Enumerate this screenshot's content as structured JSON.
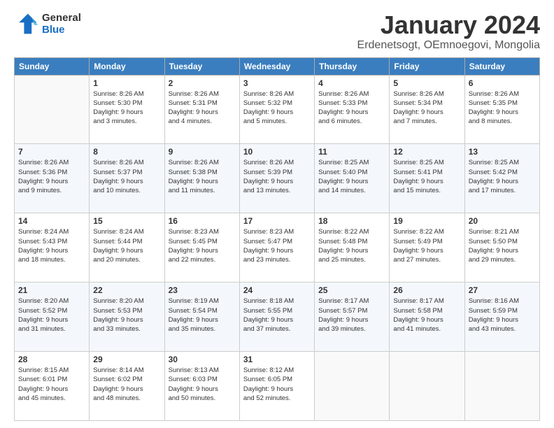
{
  "logo": {
    "line1": "General",
    "line2": "Blue"
  },
  "title": "January 2024",
  "subtitle": "Erdenetsogt, OEmnoegovi, Mongolia",
  "header_days": [
    "Sunday",
    "Monday",
    "Tuesday",
    "Wednesday",
    "Thursday",
    "Friday",
    "Saturday"
  ],
  "weeks": [
    [
      {
        "day": "",
        "info": ""
      },
      {
        "day": "1",
        "info": "Sunrise: 8:26 AM\nSunset: 5:30 PM\nDaylight: 9 hours\nand 3 minutes."
      },
      {
        "day": "2",
        "info": "Sunrise: 8:26 AM\nSunset: 5:31 PM\nDaylight: 9 hours\nand 4 minutes."
      },
      {
        "day": "3",
        "info": "Sunrise: 8:26 AM\nSunset: 5:32 PM\nDaylight: 9 hours\nand 5 minutes."
      },
      {
        "day": "4",
        "info": "Sunrise: 8:26 AM\nSunset: 5:33 PM\nDaylight: 9 hours\nand 6 minutes."
      },
      {
        "day": "5",
        "info": "Sunrise: 8:26 AM\nSunset: 5:34 PM\nDaylight: 9 hours\nand 7 minutes."
      },
      {
        "day": "6",
        "info": "Sunrise: 8:26 AM\nSunset: 5:35 PM\nDaylight: 9 hours\nand 8 minutes."
      }
    ],
    [
      {
        "day": "7",
        "info": "Sunrise: 8:26 AM\nSunset: 5:36 PM\nDaylight: 9 hours\nand 9 minutes."
      },
      {
        "day": "8",
        "info": "Sunrise: 8:26 AM\nSunset: 5:37 PM\nDaylight: 9 hours\nand 10 minutes."
      },
      {
        "day": "9",
        "info": "Sunrise: 8:26 AM\nSunset: 5:38 PM\nDaylight: 9 hours\nand 11 minutes."
      },
      {
        "day": "10",
        "info": "Sunrise: 8:26 AM\nSunset: 5:39 PM\nDaylight: 9 hours\nand 13 minutes."
      },
      {
        "day": "11",
        "info": "Sunrise: 8:25 AM\nSunset: 5:40 PM\nDaylight: 9 hours\nand 14 minutes."
      },
      {
        "day": "12",
        "info": "Sunrise: 8:25 AM\nSunset: 5:41 PM\nDaylight: 9 hours\nand 15 minutes."
      },
      {
        "day": "13",
        "info": "Sunrise: 8:25 AM\nSunset: 5:42 PM\nDaylight: 9 hours\nand 17 minutes."
      }
    ],
    [
      {
        "day": "14",
        "info": "Sunrise: 8:24 AM\nSunset: 5:43 PM\nDaylight: 9 hours\nand 18 minutes."
      },
      {
        "day": "15",
        "info": "Sunrise: 8:24 AM\nSunset: 5:44 PM\nDaylight: 9 hours\nand 20 minutes."
      },
      {
        "day": "16",
        "info": "Sunrise: 8:23 AM\nSunset: 5:45 PM\nDaylight: 9 hours\nand 22 minutes."
      },
      {
        "day": "17",
        "info": "Sunrise: 8:23 AM\nSunset: 5:47 PM\nDaylight: 9 hours\nand 23 minutes."
      },
      {
        "day": "18",
        "info": "Sunrise: 8:22 AM\nSunset: 5:48 PM\nDaylight: 9 hours\nand 25 minutes."
      },
      {
        "day": "19",
        "info": "Sunrise: 8:22 AM\nSunset: 5:49 PM\nDaylight: 9 hours\nand 27 minutes."
      },
      {
        "day": "20",
        "info": "Sunrise: 8:21 AM\nSunset: 5:50 PM\nDaylight: 9 hours\nand 29 minutes."
      }
    ],
    [
      {
        "day": "21",
        "info": "Sunrise: 8:20 AM\nSunset: 5:52 PM\nDaylight: 9 hours\nand 31 minutes."
      },
      {
        "day": "22",
        "info": "Sunrise: 8:20 AM\nSunset: 5:53 PM\nDaylight: 9 hours\nand 33 minutes."
      },
      {
        "day": "23",
        "info": "Sunrise: 8:19 AM\nSunset: 5:54 PM\nDaylight: 9 hours\nand 35 minutes."
      },
      {
        "day": "24",
        "info": "Sunrise: 8:18 AM\nSunset: 5:55 PM\nDaylight: 9 hours\nand 37 minutes."
      },
      {
        "day": "25",
        "info": "Sunrise: 8:17 AM\nSunset: 5:57 PM\nDaylight: 9 hours\nand 39 minutes."
      },
      {
        "day": "26",
        "info": "Sunrise: 8:17 AM\nSunset: 5:58 PM\nDaylight: 9 hours\nand 41 minutes."
      },
      {
        "day": "27",
        "info": "Sunrise: 8:16 AM\nSunset: 5:59 PM\nDaylight: 9 hours\nand 43 minutes."
      }
    ],
    [
      {
        "day": "28",
        "info": "Sunrise: 8:15 AM\nSunset: 6:01 PM\nDaylight: 9 hours\nand 45 minutes."
      },
      {
        "day": "29",
        "info": "Sunrise: 8:14 AM\nSunset: 6:02 PM\nDaylight: 9 hours\nand 48 minutes."
      },
      {
        "day": "30",
        "info": "Sunrise: 8:13 AM\nSunset: 6:03 PM\nDaylight: 9 hours\nand 50 minutes."
      },
      {
        "day": "31",
        "info": "Sunrise: 8:12 AM\nSunset: 6:05 PM\nDaylight: 9 hours\nand 52 minutes."
      },
      {
        "day": "",
        "info": ""
      },
      {
        "day": "",
        "info": ""
      },
      {
        "day": "",
        "info": ""
      }
    ]
  ]
}
